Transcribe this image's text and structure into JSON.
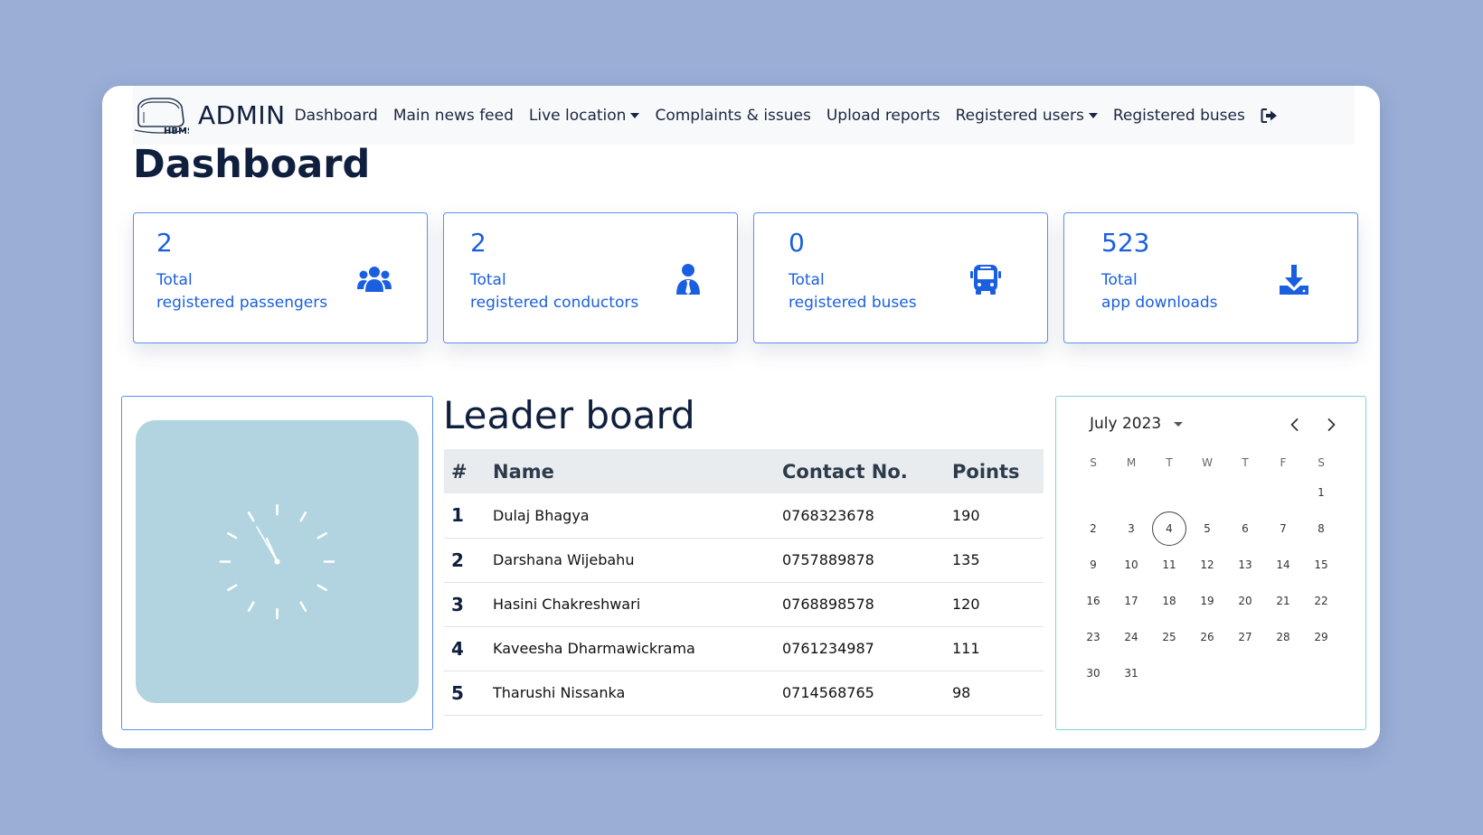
{
  "brand": {
    "title": "ADMIN",
    "logo_text": "HBMS"
  },
  "nav": {
    "items": [
      {
        "label": "Dashboard"
      },
      {
        "label": "Main news feed"
      },
      {
        "label": "Live location",
        "dropdown": true
      },
      {
        "label": "Complaints & issues"
      },
      {
        "label": "Upload reports"
      },
      {
        "label": "Registered users",
        "dropdown": true
      },
      {
        "label": "Registered buses"
      }
    ],
    "logout_icon": "sign-out-icon"
  },
  "page_title": "Dashboard",
  "stats": [
    {
      "value": "2",
      "label_line1": "Total",
      "label_line2": "registered passengers",
      "icon": "users-icon"
    },
    {
      "value": "2",
      "label_line1": "Total",
      "label_line2": "registered conductors",
      "icon": "user-tie-icon"
    },
    {
      "value": "0",
      "label_line1": "Total",
      "label_line2": "registered buses",
      "icon": "bus-icon"
    },
    {
      "value": "523",
      "label_line1": "Total",
      "label_line2": "app downloads",
      "icon": "download-icon"
    }
  ],
  "leaderboard": {
    "title": "Leader board",
    "headers": [
      "#",
      "Name",
      "Contact No.",
      "Points"
    ],
    "rows": [
      {
        "rank": "1",
        "name": "Dulaj Bhagya",
        "contact": "0768323678",
        "points": "190"
      },
      {
        "rank": "2",
        "name": "Darshana Wijebahu",
        "contact": "0757889878",
        "points": "135"
      },
      {
        "rank": "3",
        "name": "Hasini Chakreshwari",
        "contact": "0768898578",
        "points": "120"
      },
      {
        "rank": "4",
        "name": "Kaveesha Dharmawickrama",
        "contact": "0761234987",
        "points": "111"
      },
      {
        "rank": "5",
        "name": "Tharushi Nissanka",
        "contact": "0714568765",
        "points": "98"
      }
    ]
  },
  "calendar": {
    "month_label": "July 2023",
    "weekdays": [
      "S",
      "M",
      "T",
      "W",
      "T",
      "F",
      "S"
    ],
    "weeks": [
      [
        "",
        "",
        "",
        "",
        "",
        "",
        "1"
      ],
      [
        "2",
        "3",
        "4",
        "5",
        "6",
        "7",
        "8"
      ],
      [
        "9",
        "10",
        "11",
        "12",
        "13",
        "14",
        "15"
      ],
      [
        "16",
        "17",
        "18",
        "19",
        "20",
        "21",
        "22"
      ],
      [
        "23",
        "24",
        "25",
        "26",
        "27",
        "28",
        "29"
      ],
      [
        "30",
        "31",
        "",
        "",
        "",
        "",
        ""
      ]
    ],
    "today": "4"
  },
  "colors": {
    "accent": "#1a5fe0",
    "background": "#9aaed6",
    "clock_face": "#b1d4e0",
    "title": "#0f1f3d"
  }
}
